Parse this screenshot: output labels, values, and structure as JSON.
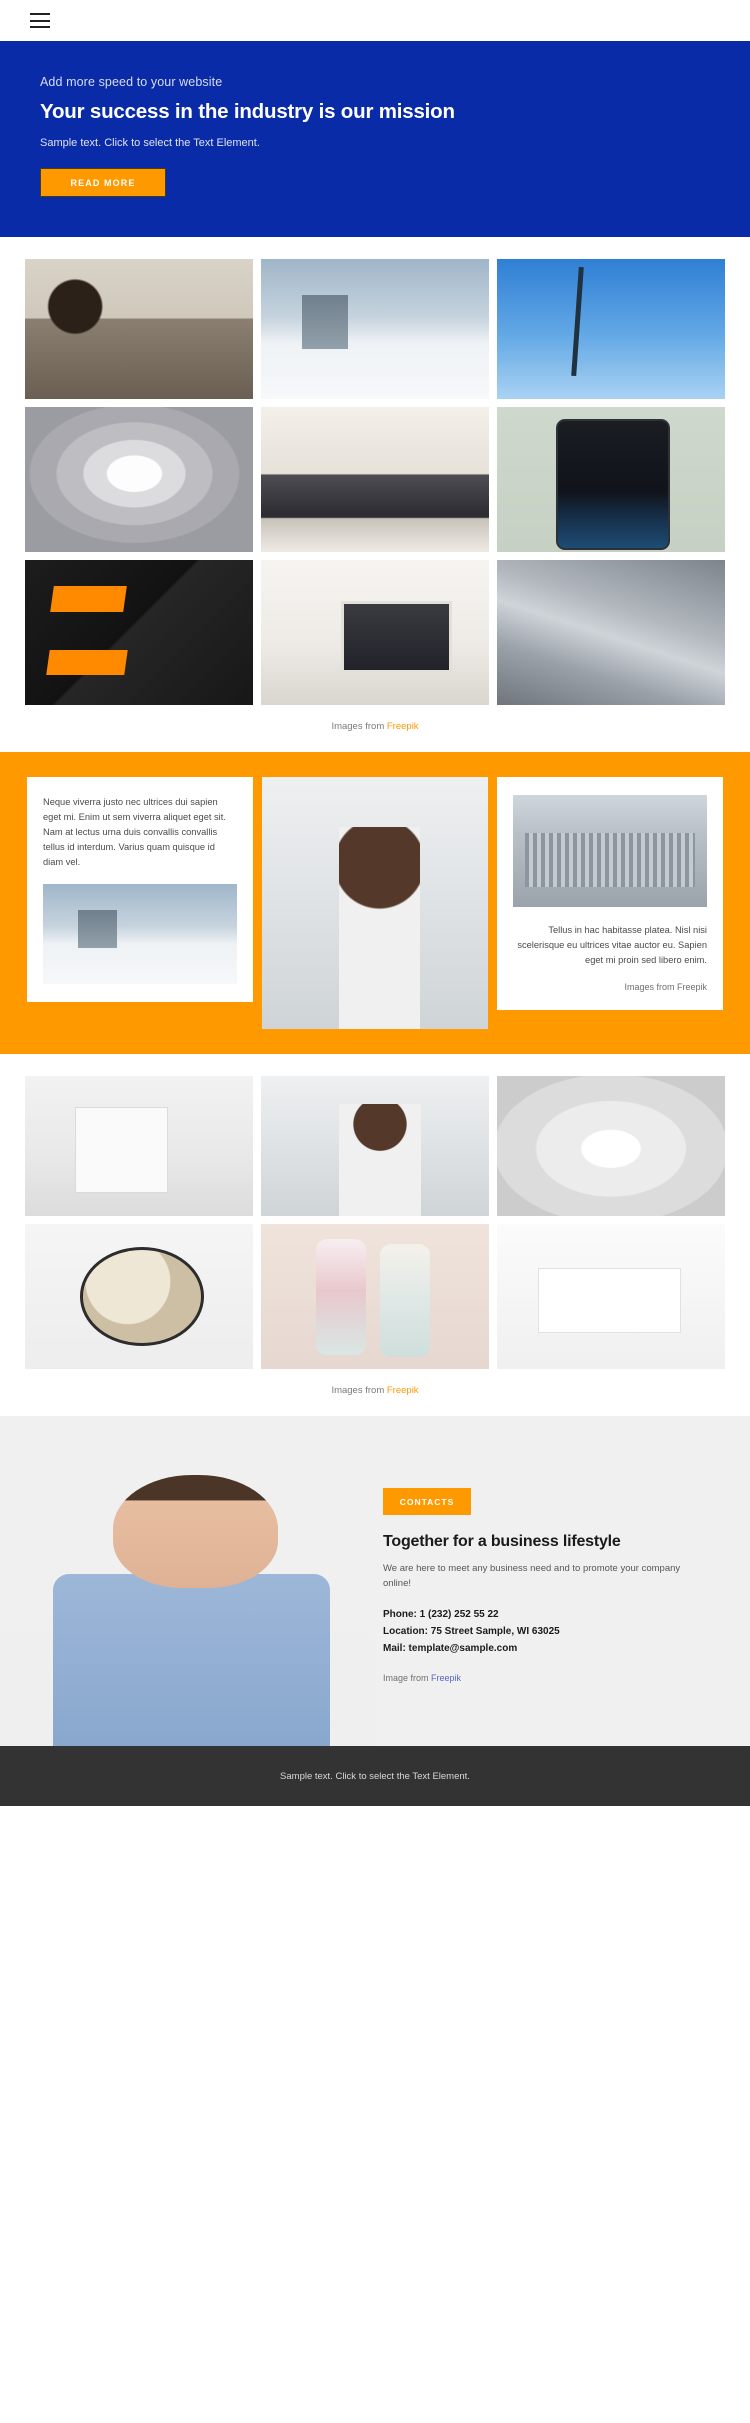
{
  "topbar": {
    "menu_icon": "hamburger-menu-icon"
  },
  "hero": {
    "kicker": "Add more speed to your website",
    "title": "Your success in the industry is our mission",
    "subtitle": "Sample text. Click to select the Text Element.",
    "button_label": "READ MORE",
    "bg_color": "#0A2BA8",
    "accent_color": "#FF9900"
  },
  "gallery_one": {
    "items": [
      {
        "name": "man-writing-at-desk"
      },
      {
        "name": "city-skyline-in-clouds"
      },
      {
        "name": "palm-tree-against-sky"
      },
      {
        "name": "white-spiral-staircase"
      },
      {
        "name": "laptop-with-marketing-graph"
      },
      {
        "name": "smartphone-showing-time"
      },
      {
        "name": "black-orange-business-cards"
      },
      {
        "name": "desk-with-laptop-and-pens"
      },
      {
        "name": "skyscraper-from-below"
      }
    ],
    "caption_prefix": "Images from ",
    "caption_link": "Freepik"
  },
  "orange_section": {
    "bg_color": "#FF9900",
    "left_card": {
      "text": "Neque viverra justo nec ultrices dui sapien eget mi. Enim ut sem viverra aliquet eget sit. Nam at lectus urna duis convallis convallis tellus id interdum. Varius quam quisque id diam vel.",
      "image_name": "city-in-clouds-photo"
    },
    "middle_card": {
      "image_name": "woman-with-laptop-photo"
    },
    "right_card": {
      "image_name": "modern-glass-building-photo",
      "text": "Tellus in hac habitasse platea. Nisl nisi scelerisque eu ultrices vitae auctor eu. Sapien eget mi proin sed libero enim.",
      "credit": "Images from Freepik"
    }
  },
  "gallery_two": {
    "items": [
      {
        "name": "notebook-and-coffee-flatlay"
      },
      {
        "name": "woman-by-window"
      },
      {
        "name": "white-curved-corridor"
      },
      {
        "name": "globe-with-sticky-note"
      },
      {
        "name": "two-cosmetic-bottles"
      },
      {
        "name": "business-meeting-table"
      }
    ],
    "caption_prefix": "Images from ",
    "caption_link": "Freepik"
  },
  "contacts": {
    "bg_color": "#f0f0f0",
    "image_name": "woman-in-blue-blazer-pointing",
    "button_label": "CONTACTS",
    "title": "Together for a business lifestyle",
    "lead": "We are here to meet any business need and to promote your company online!",
    "phone": "Phone: 1 (232) 252 55 22",
    "location": "Location: 75 Street Sample, WI 63025",
    "mail": "Mail: template@sample.com",
    "credit_prefix": "Image from ",
    "credit_link": "Freepik"
  },
  "footer": {
    "text": "Sample text. Click to select the Text Element.",
    "bg_color": "#333333"
  }
}
